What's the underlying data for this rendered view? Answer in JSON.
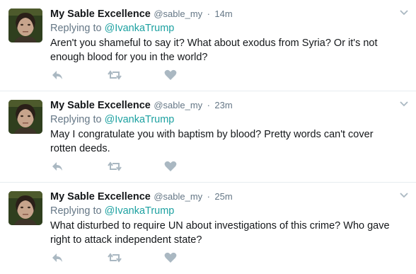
{
  "colors": {
    "muted": "#657786",
    "icon": "#aab8c2",
    "link": "#1da1a1"
  },
  "tweets": [
    {
      "name": "My Sable Excellence",
      "handle": "@sable_my",
      "time": "14m",
      "reply_prefix": "Replying to",
      "reply_to": "@IvankaTrump",
      "text": "Aren't you shameful to say it? What about exodus from Syria? Or it's not enough blood for you in the world?"
    },
    {
      "name": "My Sable Excellence",
      "handle": "@sable_my",
      "time": "23m",
      "reply_prefix": "Replying to",
      "reply_to": "@IvankaTrump",
      "text": "May I congratulate you with baptism by blood? Pretty words can't cover rotten deeds."
    },
    {
      "name": "My Sable Excellence",
      "handle": "@sable_my",
      "time": "25m",
      "reply_prefix": "Replying to",
      "reply_to": "@IvankaTrump",
      "text": "What disturbed to require UN about investigations of this crime? Who gave right to attack independent state?"
    }
  ],
  "separator": "·",
  "icons": [
    "reply-icon",
    "retweet-icon",
    "like-icon",
    "chevron-down-icon"
  ]
}
